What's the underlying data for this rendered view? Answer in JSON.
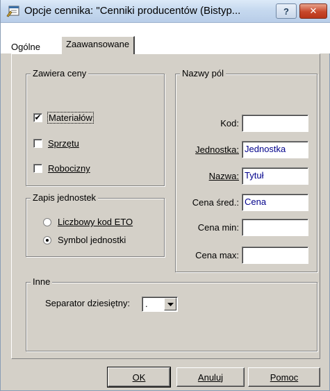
{
  "window": {
    "title": "Opcje cennika: \"Cenniki producentów (Bistyp...",
    "help_label": "?",
    "close_label": "✕"
  },
  "tabs": [
    {
      "label": "Ogólne",
      "active": false
    },
    {
      "label": "Zaawansowane",
      "active": true
    }
  ],
  "zawiera_ceny": {
    "legend": "Zawiera ceny",
    "items": [
      {
        "label": "Materiałów",
        "checked": true
      },
      {
        "label": "Sprzętu",
        "checked": false
      },
      {
        "label": "Robocizny",
        "checked": false
      }
    ]
  },
  "zapis_jednostek": {
    "legend": "Zapis jednostek",
    "options": [
      {
        "label": "Liczbowy kod ETO",
        "selected": false
      },
      {
        "label": "Symbol jednostki",
        "selected": true
      }
    ]
  },
  "nazwy_pol": {
    "legend": "Nazwy pól",
    "fields": [
      {
        "label": "Kod:",
        "value": ""
      },
      {
        "label": "Jednostka:",
        "value": "Jednostka"
      },
      {
        "label": "Nazwa:",
        "value": "Tytuł"
      },
      {
        "label": "Cena śred.:",
        "value": "Cena"
      },
      {
        "label": "Cena min:",
        "value": ""
      },
      {
        "label": "Cena max:",
        "value": ""
      }
    ]
  },
  "inne": {
    "legend": "Inne",
    "separator_label": "Separator dziesiętny:",
    "separator_value": "."
  },
  "buttons": {
    "ok": "OK",
    "cancel": "Anuluj",
    "help": "Pomoc"
  },
  "colors": {
    "dialog_bg": "#d4d0c8",
    "field_value_text": "#00008b",
    "close_button": "#c7472a"
  }
}
